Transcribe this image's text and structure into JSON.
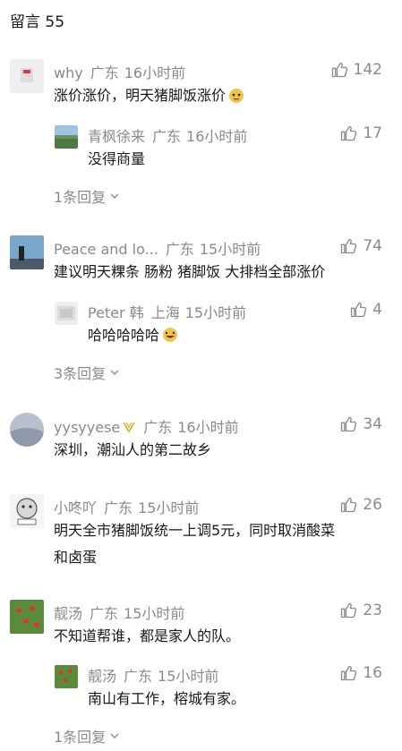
{
  "header": {
    "title": "留言 55"
  },
  "comments": [
    {
      "user": "why",
      "location": "广东",
      "time": "16小时前",
      "likes": "142",
      "text": "涨价涨价，明天猪脚饭涨价",
      "emoji": "cat-face",
      "reply": {
        "user": "青枫徐来",
        "location": "广东",
        "time": "16小时前",
        "likes": "17",
        "text": "没得商量"
      },
      "more": "1条回复"
    },
    {
      "user": "Peace and lo...",
      "location": "广东",
      "time": "15小时前",
      "likes": "74",
      "text": "建议明天粿条 肠粉 猪脚饭 大排档全部涨价",
      "reply": {
        "user": "Peter 韩",
        "location": "上海",
        "time": "15小时前",
        "likes": "4",
        "text": "哈哈哈哈哈"
      },
      "more": "3条回复"
    },
    {
      "user": "yysyyese",
      "location": "广东",
      "time": "16小时前",
      "likes": "34",
      "text": "深圳，潮汕人的第二故乡"
    },
    {
      "user": "小咚吖",
      "location": "广东",
      "time": "15小时前",
      "likes": "26",
      "text_line1": "明天全市猪脚饭统一上调5元，同时取消酸菜",
      "text_line2": "和卤蛋"
    },
    {
      "user": "靓汤",
      "location": "广东",
      "time": "15小时前",
      "likes": "23",
      "text": "不知道帮谁，都是家人的队。",
      "reply": {
        "user": "靓汤",
        "location": "广东",
        "time": "15小时前",
        "likes": "16",
        "text": "南山有工作，榕城有家。"
      },
      "more": "1条回复"
    }
  ],
  "colors": {
    "meta": "#8a8a8a",
    "text": "#1a1a1a",
    "badge": "#f0a020"
  }
}
